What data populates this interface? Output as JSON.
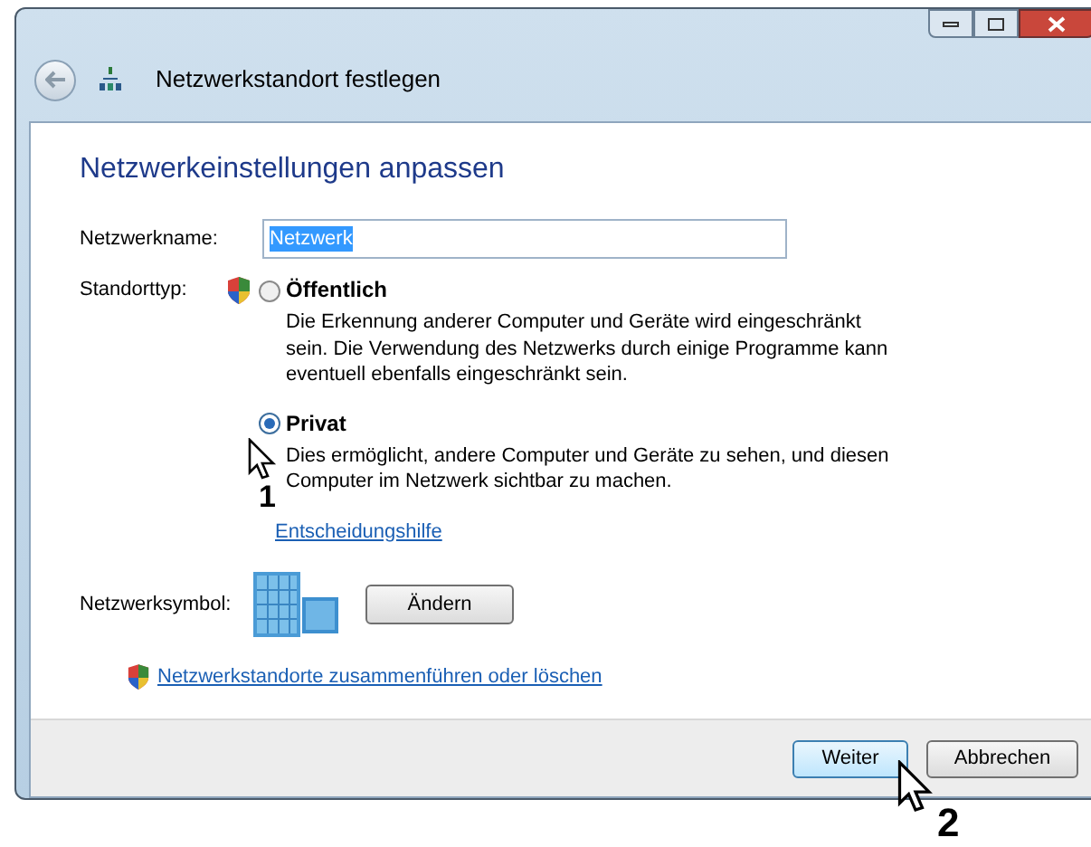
{
  "window": {
    "title": "Netzwerkstandort festlegen"
  },
  "heading": "Netzwerkeinstellungen anpassen",
  "name_field": {
    "label": "Netzwerkname:",
    "value": "Netzwerk"
  },
  "location": {
    "label": "Standorttyp:",
    "options": [
      {
        "label": "Öffentlich",
        "description": "Die Erkennung anderer Computer und Geräte wird eingeschränkt sein. Die Verwendung des Netzwerks durch einige Programme kann eventuell ebenfalls eingeschränkt sein.",
        "selected": false
      },
      {
        "label": "Privat",
        "description": "Dies ermöglicht, andere Computer und Geräte zu sehen, und diesen Computer im Netzwerk sichtbar zu machen.",
        "selected": true
      }
    ]
  },
  "help_link": "Entscheidungshilfe",
  "symbol": {
    "label": "Netzwerksymbol:",
    "button": "Ändern"
  },
  "merge_link": "Netzwerkstandorte zusammenführen oder löschen",
  "buttons": [
    {
      "label": "Weiter",
      "default": true
    },
    {
      "label": "Abbrechen",
      "default": false
    }
  ],
  "callouts": [
    "1",
    "2"
  ]
}
